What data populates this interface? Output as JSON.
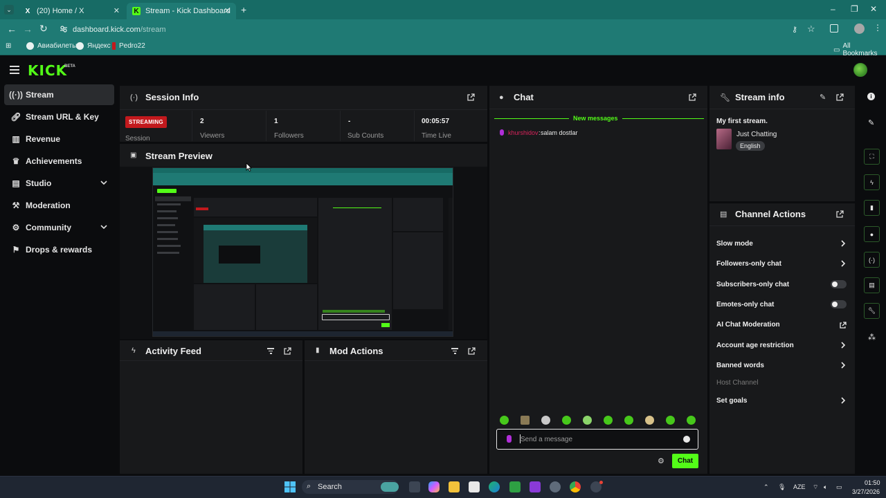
{
  "browser": {
    "tabs": [
      {
        "title": "(20) Home / X",
        "icon": "x-logo-icon"
      },
      {
        "title": "Stream - Kick Dashboard",
        "icon": "kick-logo-icon"
      }
    ],
    "url_host": "dashboard.kick.com",
    "url_path": "/stream",
    "bookmarks": [
      "Авиабилеты",
      "Яндекс",
      "Pedro22"
    ],
    "all_bookmarks": "All Bookmarks"
  },
  "app": {
    "logo": "KICK",
    "logo_badge": "BETA"
  },
  "sidebar": {
    "items": [
      {
        "label": "Stream",
        "icon": "stream-icon",
        "active": true
      },
      {
        "label": "Stream URL & Key",
        "icon": "link-icon"
      },
      {
        "label": "Revenue",
        "icon": "revenue-icon"
      },
      {
        "label": "Achievements",
        "icon": "trophy-icon"
      },
      {
        "label": "Studio",
        "icon": "studio-icon",
        "expandable": true
      },
      {
        "label": "Moderation",
        "icon": "hammer-icon"
      },
      {
        "label": "Community",
        "icon": "community-icon",
        "expandable": true
      },
      {
        "label": "Drops & rewards",
        "icon": "gift-icon"
      }
    ]
  },
  "session": {
    "title": "Session Info",
    "badge": "STREAMING",
    "badge_label": "Session",
    "stats": [
      {
        "value": "2",
        "label": "Viewers"
      },
      {
        "value": "1",
        "label": "Followers"
      },
      {
        "value": "-",
        "label": "Sub Counts"
      },
      {
        "value": "00:05:57",
        "label": "Time Live"
      }
    ]
  },
  "preview": {
    "title": "Stream Preview"
  },
  "activity": {
    "title": "Activity Feed"
  },
  "mod_actions": {
    "title": "Mod Actions"
  },
  "chat": {
    "title": "Chat",
    "new_messages": "New messages",
    "messages": [
      {
        "user": "khurshidov",
        "separator": ": ",
        "text": "salam dostlar"
      }
    ],
    "placeholder": "Send a message",
    "send_label": "Chat"
  },
  "stream_info": {
    "title": "Stream info",
    "stream_title": "My first stream.",
    "category": "Just Chatting",
    "language": "English"
  },
  "channel_actions": {
    "title": "Channel Actions",
    "items": [
      {
        "label": "Slow mode",
        "control": "chevron"
      },
      {
        "label": "Followers-only chat",
        "control": "chevron"
      },
      {
        "label": "Subscribers-only chat",
        "control": "toggle",
        "enabled": false
      },
      {
        "label": "Emotes-only chat",
        "control": "toggle",
        "enabled": false
      },
      {
        "label": "AI Chat Moderation",
        "control": "external"
      },
      {
        "label": "Account age restriction",
        "control": "chevron"
      },
      {
        "label": "Banned words",
        "control": "chevron"
      },
      {
        "label": "Host Channel",
        "control": "none",
        "disabled": true
      },
      {
        "label": "Set goals",
        "control": "chevron"
      }
    ]
  },
  "taskbar": {
    "search": "Search",
    "lang": "AZE",
    "time": "01:50",
    "date": "3/27/2026"
  },
  "colors": {
    "brand_green": "#53fc18",
    "chrome_teal": "#176b65",
    "streaming_red": "#c2191d",
    "username_pink": "#d8235b"
  }
}
